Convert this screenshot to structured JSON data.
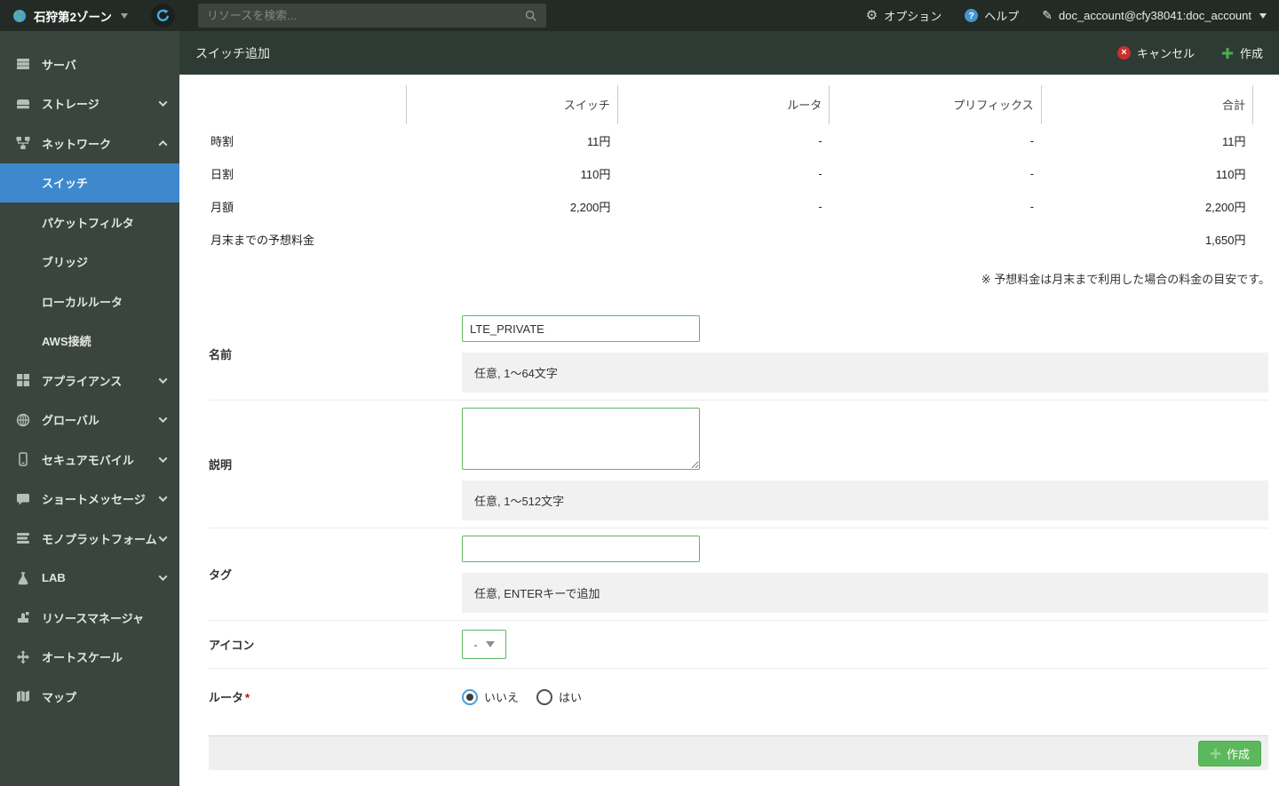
{
  "header": {
    "zone": "石狩第2ゾーン",
    "search_placeholder": "リソースを検索...",
    "options": "オプション",
    "help": "ヘルプ",
    "account": "doc_account@cfy38041:doc_account"
  },
  "toolbar": {
    "title": "スイッチ追加",
    "cancel": "キャンセル",
    "create": "作成"
  },
  "sidebar": {
    "items": [
      {
        "label": "サーバ"
      },
      {
        "label": "ストレージ"
      },
      {
        "label": "ネットワーク"
      },
      {
        "label": "アプライアンス"
      },
      {
        "label": "グローバル"
      },
      {
        "label": "セキュアモバイル"
      },
      {
        "label": "ショートメッセージ"
      },
      {
        "label": "モノプラットフォーム"
      },
      {
        "label": "LAB"
      },
      {
        "label": "リソースマネージャ"
      },
      {
        "label": "オートスケール"
      },
      {
        "label": "マップ"
      }
    ],
    "network_subitems": [
      {
        "label": "スイッチ",
        "active": true
      },
      {
        "label": "パケットフィルタ"
      },
      {
        "label": "ブリッジ"
      },
      {
        "label": "ローカルルータ"
      },
      {
        "label": "AWS接続"
      }
    ]
  },
  "pricing": {
    "columns": [
      "スイッチ",
      "ルータ",
      "プリフィックス",
      "合計"
    ],
    "rows": [
      {
        "label": "時割",
        "values": [
          "11円",
          "-",
          "-",
          "11円"
        ]
      },
      {
        "label": "日割",
        "values": [
          "110円",
          "-",
          "-",
          "110円"
        ]
      },
      {
        "label": "月額",
        "values": [
          "2,200円",
          "-",
          "-",
          "2,200円"
        ]
      },
      {
        "label": "月末までの予想料金",
        "values": [
          "",
          "",
          "",
          "1,650円"
        ]
      }
    ],
    "note": "※ 予想料金は月末まで利用した場合の料金の目安です。"
  },
  "form": {
    "name": {
      "label": "名前",
      "value": "LTE_PRIVATE",
      "help": "任意, 1〜64文字"
    },
    "description": {
      "label": "説明",
      "help": "任意, 1〜512文字"
    },
    "tag": {
      "label": "タグ",
      "help": "任意, ENTERキーで追加"
    },
    "icon": {
      "label": "アイコン",
      "value": "-"
    },
    "router": {
      "label": "ルータ",
      "required": "*",
      "option_no": "いいえ",
      "option_yes": "はい",
      "selected": "いいえ"
    },
    "submit": "作成"
  },
  "colors": {
    "accent_green": "#5cb85c",
    "accent_blue": "#3e89ce",
    "cancel_red": "#c9302c",
    "sidebar_bg": "#3b453f",
    "topbar_bg": "#242b26"
  }
}
